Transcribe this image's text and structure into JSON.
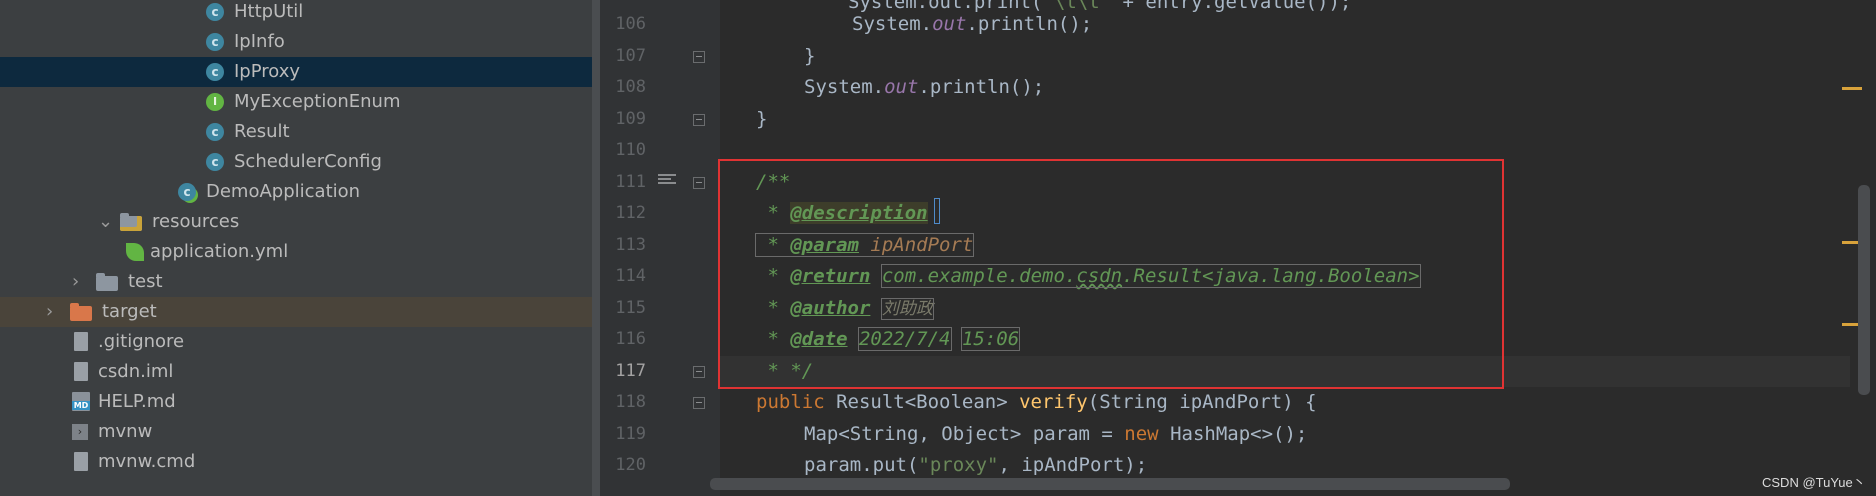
{
  "project_tree": {
    "items": [
      {
        "label": "HttpUtil",
        "icon": "class-icon"
      },
      {
        "label": "IpInfo",
        "icon": "class-icon"
      },
      {
        "label": "IpProxy",
        "icon": "class-icon",
        "selected": true
      },
      {
        "label": "MyExceptionEnum",
        "icon": "interface-icon"
      },
      {
        "label": "Result",
        "icon": "class-icon"
      },
      {
        "label": "SchedulerConfig",
        "icon": "class-icon"
      },
      {
        "label": "DemoApplication",
        "icon": "spring-boot-class-icon"
      },
      {
        "label": "resources",
        "icon": "resources-folder-icon",
        "expanded": true
      },
      {
        "label": "application.yml",
        "icon": "spring-config-icon"
      },
      {
        "label": "test",
        "icon": "folder-icon",
        "expanded": false
      },
      {
        "label": "target",
        "icon": "excluded-folder-icon",
        "expanded": false
      },
      {
        "label": ".gitignore",
        "icon": "file-icon"
      },
      {
        "label": "csdn.iml",
        "icon": "module-file-icon"
      },
      {
        "label": "HELP.md",
        "icon": "markdown-icon",
        "icon_text": "MD"
      },
      {
        "label": "mvnw",
        "icon": "terminal-script-icon"
      },
      {
        "label": "mvnw.cmd",
        "icon": "text-file-icon"
      }
    ]
  },
  "editor": {
    "line_numbers": [
      "106",
      "107",
      "108",
      "109",
      "110",
      "111",
      "112",
      "113",
      "114",
      "115",
      "116",
      "117",
      "118",
      "119",
      "120"
    ],
    "current_line": "117",
    "code": {
      "l106_obj": "System.",
      "l106_out": "out",
      "l106_call": ".println();",
      "l107": "}",
      "l108_obj": "System.",
      "l108_out": "out",
      "l108_call": ".println();",
      "l109": "}",
      "l111": "/**",
      "star": " * ",
      "tag_description": "@description",
      "tag_param": "@param",
      "param_name": "ipAndPort",
      "tag_return": "@return",
      "return_type_prefix": "com.example.demo.",
      "return_type_typo": "csdn",
      "return_type_suffix": ".Result<java.lang.Boolean>",
      "tag_author": "@author",
      "author_value": "刘助政",
      "tag_date": "@date",
      "date_value": "2022/7/4",
      "time_value": "15:06",
      "l117": " * */",
      "l118_public": "public ",
      "l118_type": "Result<Boolean> ",
      "l118_method": "verify",
      "l118_rest": "(String ipAndPort) {",
      "l119_decl": "Map<String, Object> param = ",
      "l119_new": "new ",
      "l119_rest": "HashMap<>();",
      "l120_call": "param.put(",
      "l120_str": "\"proxy\"",
      "l120_rest": ", ipAndPort);"
    }
  },
  "watermark": "CSDN @TuYue丶",
  "colors": {
    "highlight_box": "#e03333",
    "selection": "#0d293e",
    "doc_comment": "#629755",
    "keyword": "#cc7832"
  }
}
